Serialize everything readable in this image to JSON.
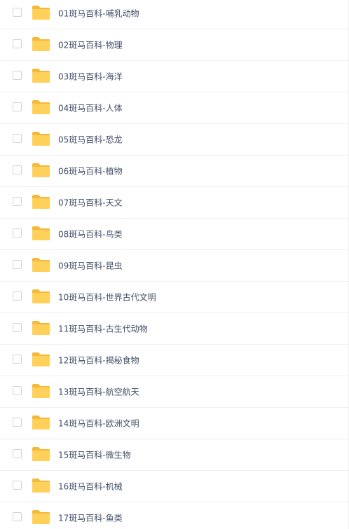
{
  "files": [
    {
      "name": "01斑马百科-哺乳动物"
    },
    {
      "name": "02斑马百科-物理"
    },
    {
      "name": "03斑马百科-海洋"
    },
    {
      "name": "04斑马百科-人体"
    },
    {
      "name": "05斑马百科-恐龙"
    },
    {
      "name": "06斑马百科-植物"
    },
    {
      "name": "07斑马百科-天文"
    },
    {
      "name": "08斑马百科-鸟类"
    },
    {
      "name": "09斑马百科-昆虫"
    },
    {
      "name": "10斑马百科-世界古代文明"
    },
    {
      "name": "11斑马百科-古生代动物"
    },
    {
      "name": "12斑马百科-揭秘食物"
    },
    {
      "name": "13斑马百科-航空航天"
    },
    {
      "name": "14斑马百科-欧洲文明"
    },
    {
      "name": "15斑马百科-微生物"
    },
    {
      "name": "16斑马百科-机械"
    },
    {
      "name": "17斑马百科-鱼类"
    }
  ],
  "colors": {
    "folder_body": "#ffd15b",
    "folder_tab": "#f5b939",
    "text": "#424e67"
  },
  "icons": {
    "folder": "folder-icon",
    "checkbox": "checkbox-icon"
  }
}
